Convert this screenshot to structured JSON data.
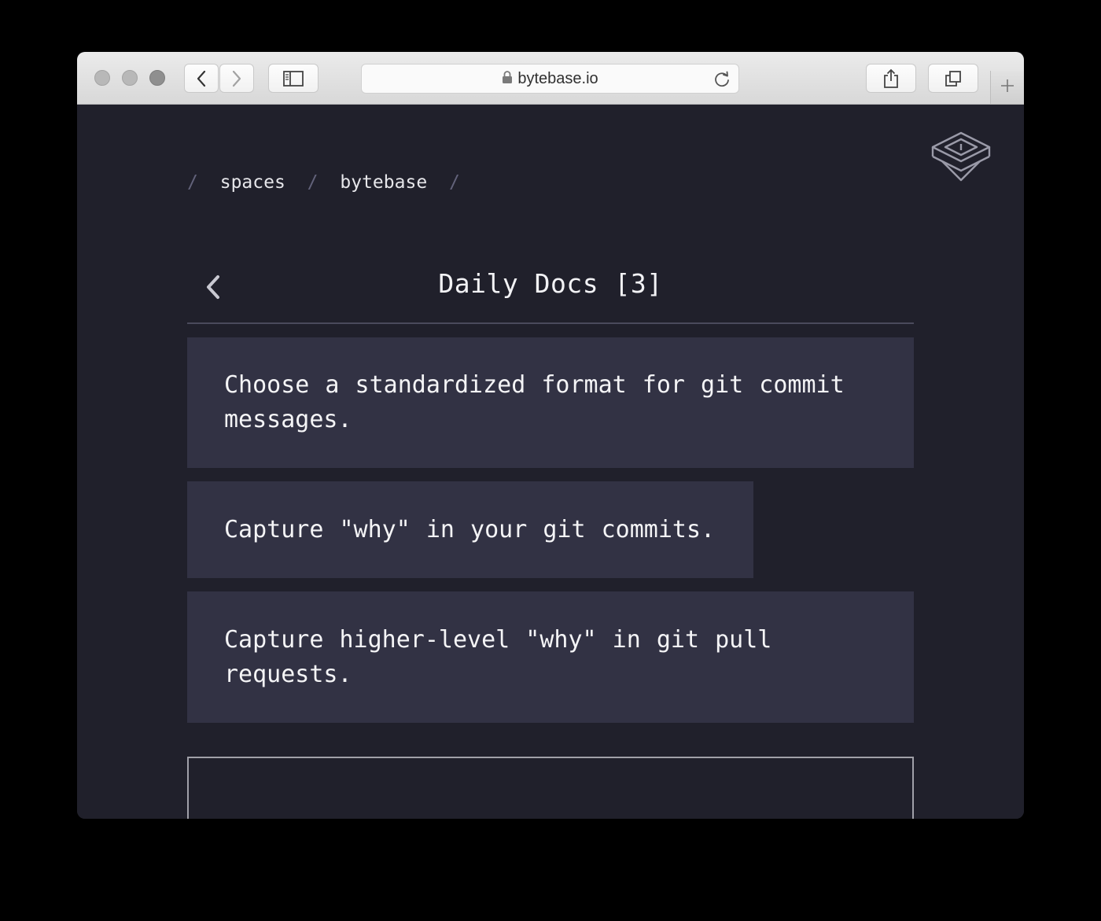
{
  "browser": {
    "url": "bytebase.io",
    "colors": {
      "chrome": "#e0e0e0",
      "traffic_light": "#b8b8b8"
    },
    "icons": {
      "back": "chevron-left-icon",
      "forward": "chevron-right-icon",
      "sidebar": "sidebar-icon",
      "lock": "lock-icon",
      "reload": "reload-icon",
      "share": "share-icon",
      "tabs": "tabs-overview-icon",
      "new_tab": "plus-icon"
    }
  },
  "app": {
    "colors": {
      "background": "#20202b",
      "card": "#323244",
      "text": "#f4f4f6",
      "separator": "#62627a"
    },
    "logo_icon": "stacked-layers-logo-icon",
    "breadcrumb": {
      "separator": "/",
      "items": [
        "spaces",
        "bytebase"
      ]
    },
    "back_icon": "chevron-left-icon",
    "title": "Daily Docs [3]",
    "docs": [
      {
        "text": "Choose a standardized format for git commit messages."
      },
      {
        "text": "Capture \"why\" in your git commits."
      },
      {
        "text": "Capture higher-level \"why\" in git pull requests."
      }
    ],
    "new_doc_input": {
      "value": "",
      "placeholder": ""
    }
  }
}
